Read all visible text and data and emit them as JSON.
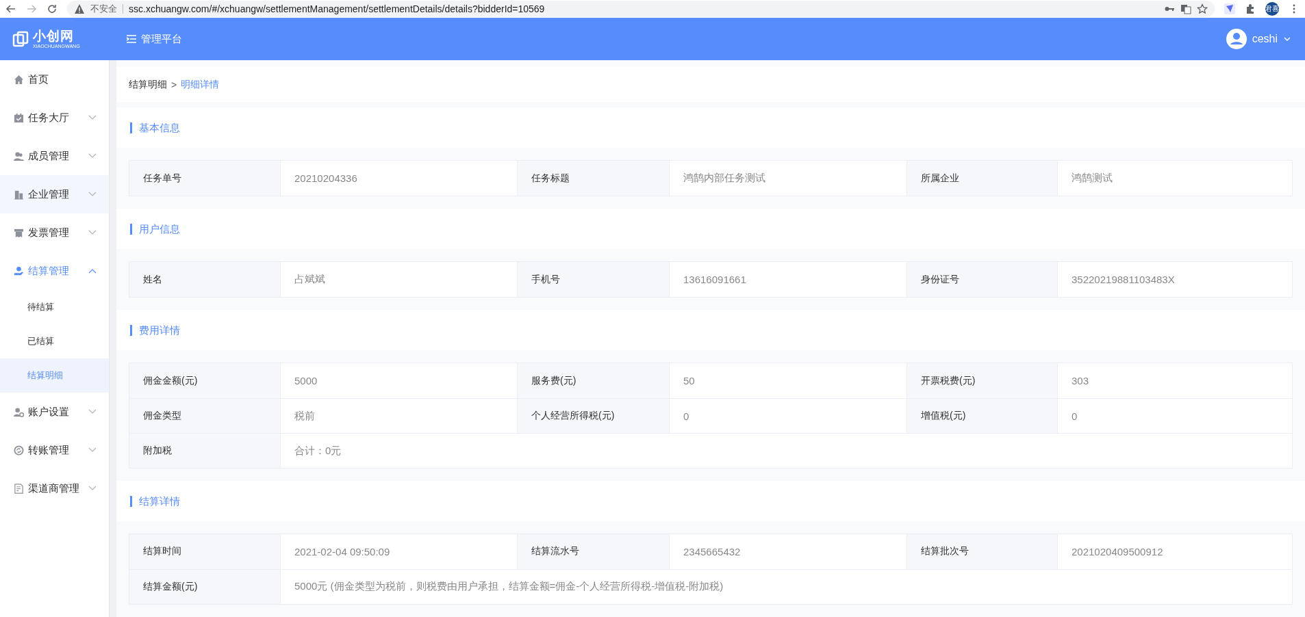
{
  "browser": {
    "security_label": "不安全",
    "url": "ssc.xchuangw.com/#/xchuangw/settlementManagement/settlementDetails/details?bidderId=10569",
    "profile": "君喜"
  },
  "header": {
    "logo_text": "小创网",
    "logo_subtext": "XIAOCHUANGWANG",
    "title": "管理平台",
    "user": "ceshi"
  },
  "sidebar": {
    "items": [
      {
        "label": "首页",
        "kind": "link",
        "selected": false,
        "hovered": false
      },
      {
        "label": "任务大厅",
        "kind": "group",
        "expanded": false,
        "selected": false,
        "hovered": false
      },
      {
        "label": "成员管理",
        "kind": "group",
        "expanded": false,
        "selected": false,
        "hovered": false
      },
      {
        "label": "企业管理",
        "kind": "group",
        "expanded": false,
        "selected": false,
        "hovered": true
      },
      {
        "label": "发票管理",
        "kind": "group",
        "expanded": false,
        "selected": false,
        "hovered": false
      },
      {
        "label": "结算管理",
        "kind": "group",
        "expanded": true,
        "selected": true,
        "hovered": false,
        "children": [
          {
            "label": "待结算",
            "selected": false
          },
          {
            "label": "已结算",
            "selected": false
          },
          {
            "label": "结算明细",
            "selected": true
          }
        ]
      },
      {
        "label": "账户设置",
        "kind": "group",
        "expanded": false,
        "selected": false,
        "hovered": false
      },
      {
        "label": "转账管理",
        "kind": "group",
        "expanded": false,
        "selected": false,
        "hovered": false
      },
      {
        "label": "渠道商管理",
        "kind": "group",
        "expanded": false,
        "selected": false,
        "hovered": false
      }
    ]
  },
  "breadcrumb": [
    {
      "label": "结算明细",
      "current": false
    },
    {
      "label": "明细详情",
      "current": true
    }
  ],
  "breadcrumb_separator": ">",
  "sections": [
    {
      "title": "基本信息",
      "rows": [
        [
          {
            "label": "任务单号",
            "value": "20210204336"
          },
          {
            "label": "任务标题",
            "value": "鸿鹄内部任务测试"
          },
          {
            "label": "所属企业",
            "value": "鸿鹄测试"
          }
        ]
      ]
    },
    {
      "title": "用户信息",
      "rows": [
        [
          {
            "label": "姓名",
            "value": "占斌斌"
          },
          {
            "label": "手机号",
            "value": "13616091661"
          },
          {
            "label": "身份证号",
            "value": "35220219881103483X"
          }
        ]
      ]
    },
    {
      "title": "费用详情",
      "rows": [
        [
          {
            "label": "佣金金额(元)",
            "value": "5000"
          },
          {
            "label": "服务费(元)",
            "value": "50"
          },
          {
            "label": "开票税费(元)",
            "value": "303"
          }
        ],
        [
          {
            "label": "佣金类型",
            "value": "税前"
          },
          {
            "label": "个人经营所得税(元)",
            "value": "0"
          },
          {
            "label": "增值税(元)",
            "value": "0"
          }
        ],
        [
          {
            "label": "附加税",
            "value": "合计：0元"
          }
        ]
      ]
    },
    {
      "title": "结算详情",
      "rows": [
        [
          {
            "label": "结算时间",
            "value": "2021-02-04 09:50:09"
          },
          {
            "label": "结算流水号",
            "value": "2345665432"
          },
          {
            "label": "结算批次号",
            "value": "2021020409500912"
          }
        ],
        [
          {
            "label": "结算金额(元)",
            "value": "5000元 (佣金类型为税前，则税费由用户承担，结算金额=佣金-个人经营所得税-增值税-附加税)"
          }
        ]
      ]
    }
  ]
}
